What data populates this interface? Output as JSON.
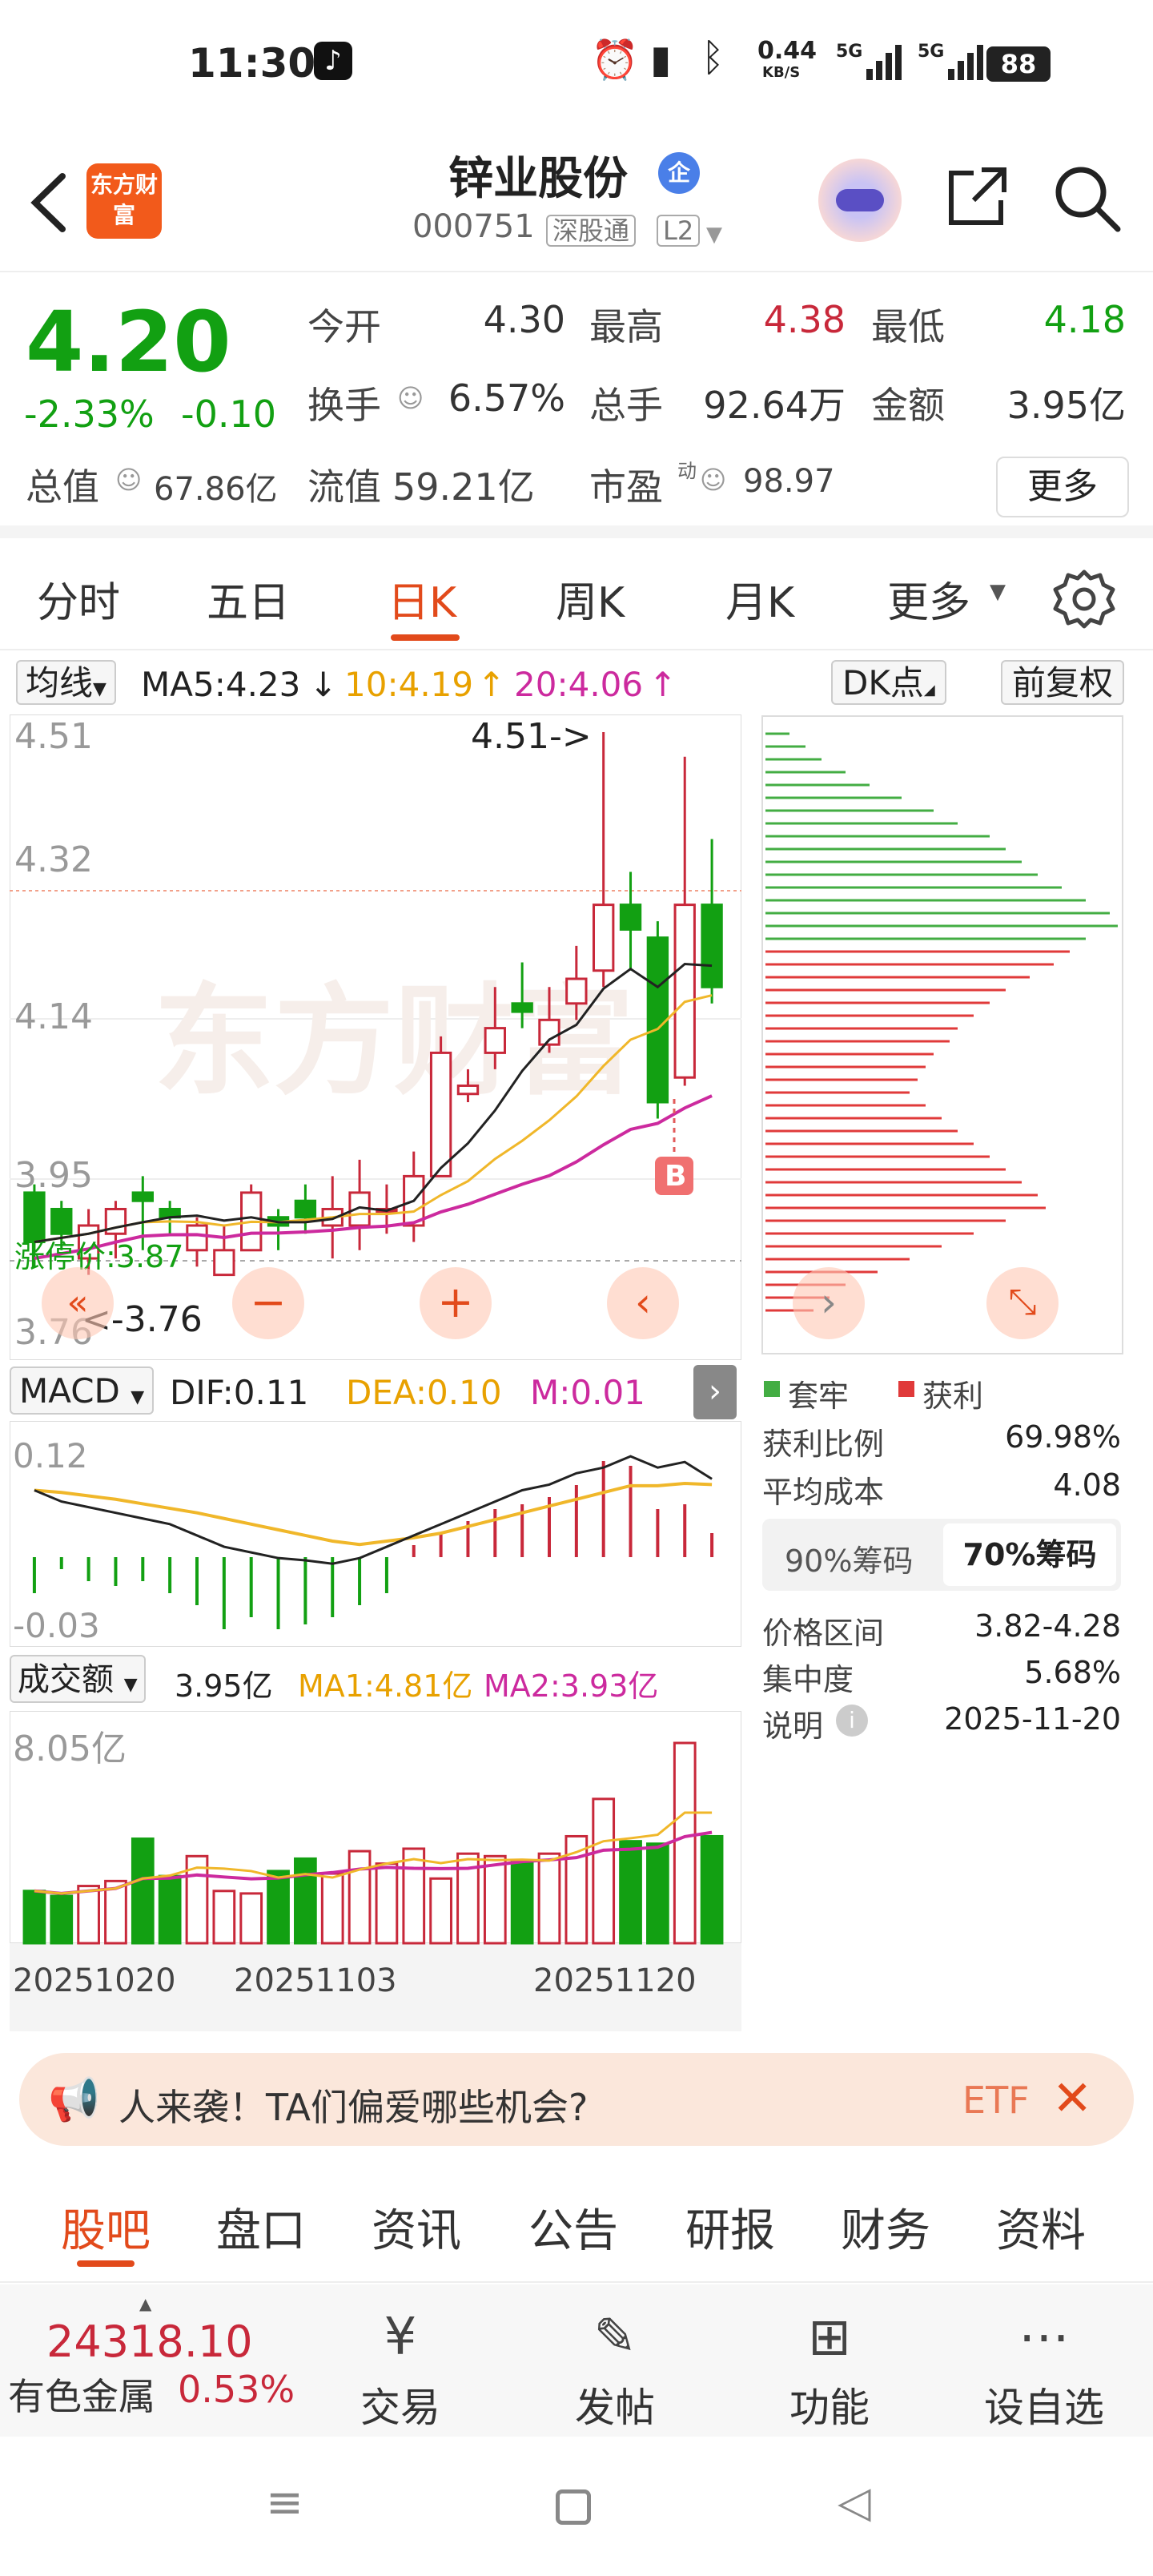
{
  "status": {
    "time": "11:30",
    "net_speed": "0.44",
    "net_unit": "KB/S",
    "signal1": "5G",
    "signal2": "5G",
    "battery": "88"
  },
  "header": {
    "logo_text": "东方财富",
    "title": "锌业股份",
    "badge": "企",
    "code": "000751",
    "tag1": "深股通",
    "tag2": "L2"
  },
  "quote": {
    "price": "4.20",
    "pct": "-2.33%",
    "chg": "-0.10",
    "open_l": "今开",
    "open_v": "4.30",
    "high_l": "最高",
    "high_v": "4.38",
    "low_l": "最低",
    "low_v": "4.18",
    "turn_l": "换手",
    "turn_v": "6.57%",
    "vol_l": "总手",
    "vol_v": "92.64万",
    "amt_l": "金额",
    "amt_v": "3.95亿",
    "mcap_l": "总值",
    "mcap_v": "67.86亿",
    "flt_l": "流值",
    "flt_v": "59.21亿",
    "pe_l": "市盈",
    "pe_sup": "动",
    "pe_v": "98.97",
    "more": "更多"
  },
  "tabs": [
    "分时",
    "五日",
    "日K",
    "周K",
    "月K",
    "更多"
  ],
  "ma": {
    "sel": "均线",
    "ma5": "MA5:4.23",
    "ma10": "10:4.19",
    "ma20": "20:4.06",
    "dk": "DK点",
    "fq": "前复权"
  },
  "kchart": {
    "y_labels": [
      "4.51",
      "4.32",
      "4.14",
      "3.95",
      "3.76"
    ],
    "peak": "4.51->",
    "low": "<-3.76",
    "limit": "涨停价:3.87",
    "marker": "B"
  },
  "macd": {
    "sel": "MACD",
    "dif": "DIF:0.11",
    "dea": "DEA:0.10",
    "m": "M:0.01",
    "y_top": "0.12",
    "y_bot": "-0.03"
  },
  "vol": {
    "sel": "成交额",
    "val": "3.95亿",
    "ma1": "MA1:4.81亿",
    "ma2": "MA2:3.93亿",
    "y_top": "8.05亿",
    "dates": [
      "20251020",
      "20251103",
      "20251120"
    ]
  },
  "chips": {
    "legend1": "套牢",
    "legend2": "获利",
    "rows": [
      [
        "获利比例",
        "69.98%"
      ],
      [
        "平均成本",
        "4.08"
      ]
    ],
    "tab1": "90%筹码",
    "tab2": "70%筹码",
    "rows2": [
      [
        "价格区间",
        "3.82-4.28"
      ],
      [
        "集中度",
        "5.68%"
      ],
      [
        "说明",
        "2025-11-20"
      ]
    ]
  },
  "ad": {
    "text": "人来袭！TA们偏爱哪些机会?",
    "tail": "ETF"
  },
  "btabs": [
    "股吧",
    "盘口",
    "资讯",
    "公告",
    "研报",
    "财务",
    "资料"
  ],
  "bottom": {
    "index_val": "24318.10",
    "index_name": "有色金属",
    "index_pct": "0.53%",
    "trade": "交易",
    "post": "发帖",
    "func": "功能",
    "watch": "设自选"
  },
  "colors": {
    "red": "#c8283a",
    "green": "#12a012",
    "orange": "#e24a1b"
  }
}
